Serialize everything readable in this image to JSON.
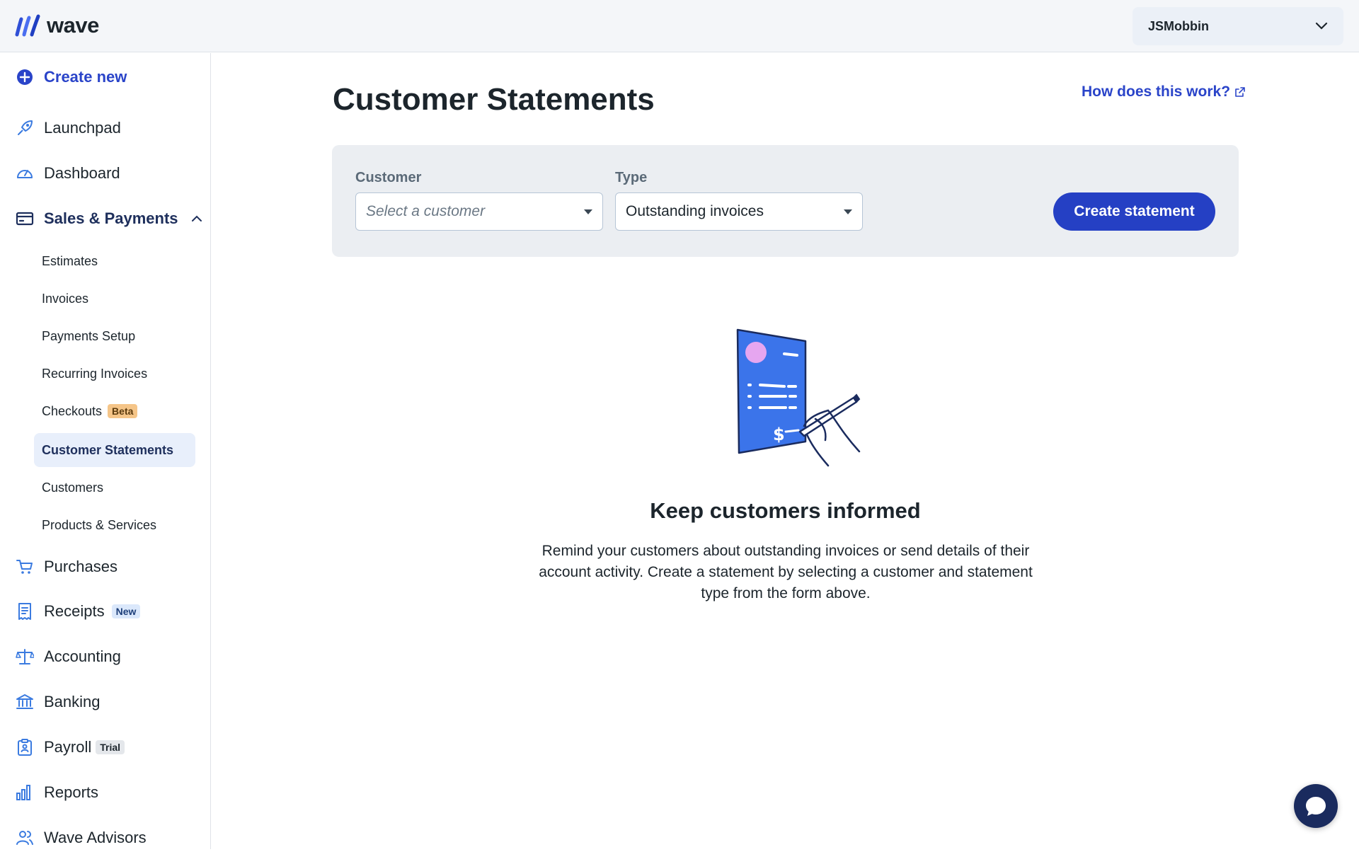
{
  "app": {
    "logo_text": "wave"
  },
  "account": {
    "name": "JSMobbin"
  },
  "sidebar": {
    "create_new": "Create new",
    "launchpad": "Launchpad",
    "dashboard": "Dashboard",
    "sales_payments": "Sales & Payments",
    "sub_items": {
      "estimates": "Estimates",
      "invoices": "Invoices",
      "payments_setup": "Payments Setup",
      "recurring_invoices": "Recurring Invoices",
      "checkouts": "Checkouts",
      "checkouts_badge": "Beta",
      "customer_statements": "Customer Statements",
      "customers": "Customers",
      "products_services": "Products & Services"
    },
    "purchases": "Purchases",
    "receipts": "Receipts",
    "receipts_badge": "New",
    "accounting": "Accounting",
    "banking": "Banking",
    "payroll": "Payroll",
    "payroll_badge": "Trial",
    "reports": "Reports",
    "wave_advisors": "Wave Advisors"
  },
  "main": {
    "title": "Customer Statements",
    "help_link": "How does this work?",
    "form": {
      "customer_label": "Customer",
      "customer_placeholder": "Select a customer",
      "type_label": "Type",
      "type_value": "Outstanding invoices",
      "create_button": "Create statement"
    },
    "empty_state": {
      "title": "Keep customers informed",
      "description": "Remind your customers about outstanding invoices or send details of their account activity. Create a statement by selecting a customer and statement type from the form above."
    }
  },
  "colors": {
    "brand_blue": "#2540c4",
    "link_blue": "#2a44c9",
    "nav_active_bg": "#e8effb",
    "topbar_bg": "#f4f6f9"
  }
}
